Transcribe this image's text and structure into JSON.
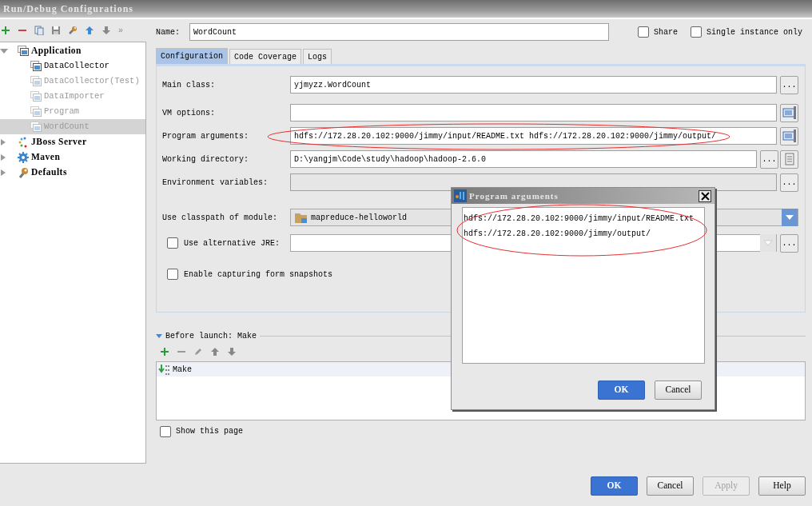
{
  "window": {
    "title": "Run/Debug Configurations"
  },
  "toolbar": {
    "overflow": "»"
  },
  "tree": [
    {
      "label": "Application",
      "kind": "application",
      "expanded": true,
      "selected": false,
      "children": [
        {
          "label": "DataCollector",
          "disabled": false,
          "selected": false
        },
        {
          "label": "DataCollector(Test)",
          "disabled": true,
          "selected": false
        },
        {
          "label": "DataImporter",
          "disabled": true,
          "selected": false
        },
        {
          "label": "Program",
          "disabled": true,
          "selected": false
        },
        {
          "label": "WordCount",
          "disabled": true,
          "selected": true
        }
      ]
    },
    {
      "label": "JBoss Server",
      "kind": "jboss",
      "expanded": false,
      "selected": false
    },
    {
      "label": "Maven",
      "kind": "maven",
      "expanded": false,
      "selected": false
    },
    {
      "label": "Defaults",
      "kind": "defaults",
      "expanded": false,
      "selected": false
    }
  ],
  "name_field": {
    "label": "Name:",
    "value": "WordCount"
  },
  "options": [
    {
      "label": "Share",
      "checked": false
    },
    {
      "label": "Single instance only",
      "checked": false
    }
  ],
  "tabs": [
    {
      "label": "Configuration",
      "selected": true
    },
    {
      "label": "Code Coverage",
      "selected": false
    },
    {
      "label": "Logs",
      "selected": false
    }
  ],
  "fields": [
    {
      "kind": "text",
      "label": "Main class:",
      "value": "yjmyzz.WordCount",
      "disabled": false,
      "actions": [
        {
          "kind": "ellipsis",
          "label": "..."
        }
      ]
    },
    {
      "kind": "text",
      "label": "VM options:",
      "disabled": false,
      "actions": [
        {
          "kind": "expand"
        }
      ]
    },
    {
      "kind": "text",
      "label": "Program arguments:",
      "value": "hdfs://172.28.20.102:9000/jimmy/input/README.txt hdfs://172.28.20.102:9000/jimmy/output/",
      "disabled": false,
      "actions": [
        {
          "kind": "expand"
        }
      ]
    },
    {
      "kind": "text",
      "label": "Working directory:",
      "value": "D:\\yangjm\\Code\\study\\hadoop\\hadoop-2.6.0",
      "disabled": false,
      "actions": [
        {
          "kind": "ellipsis",
          "label": "..."
        },
        {
          "kind": "document"
        }
      ]
    },
    {
      "kind": "text",
      "label": "Environment variables:",
      "disabled": true,
      "actions": [
        {
          "kind": "ellipsis",
          "label": "..."
        }
      ]
    },
    {
      "kind": "combo",
      "label": "Use classpath of module:",
      "value": "mapreduce-helloworld",
      "disabled": false
    },
    {
      "kind": "check-combo",
      "label": "Use alternative JRE:",
      "checked": false,
      "disabled": true,
      "actions": [
        {
          "kind": "ellipsis",
          "label": "..."
        }
      ]
    },
    {
      "kind": "checkbox",
      "label": "Enable capturing form snapshots",
      "checked": false
    }
  ],
  "before_launch": {
    "label": "Before launch: Make",
    "expanded": true,
    "tasks": [
      {
        "label": "Make",
        "selected": true
      }
    ]
  },
  "show_page": {
    "label": "Show this page",
    "checked": false
  },
  "buttons": [
    {
      "label": "OK",
      "kind": "primary",
      "disabled": false
    },
    {
      "label": "Cancel",
      "kind": "default",
      "disabled": false
    },
    {
      "label": "Apply",
      "kind": "default",
      "disabled": true
    },
    {
      "label": "Help",
      "kind": "default",
      "disabled": false
    }
  ],
  "dialog": {
    "title": "Program arguments",
    "lines": [
      "hdfs://172.28.20.102:9000/jimmy/input/README.txt",
      "hdfs://172.28.20.102:9000/jimmy/output/"
    ],
    "buttons": [
      {
        "label": "OK",
        "kind": "primary",
        "disabled": false
      },
      {
        "label": "Cancel",
        "kind": "default",
        "disabled": false
      }
    ]
  }
}
